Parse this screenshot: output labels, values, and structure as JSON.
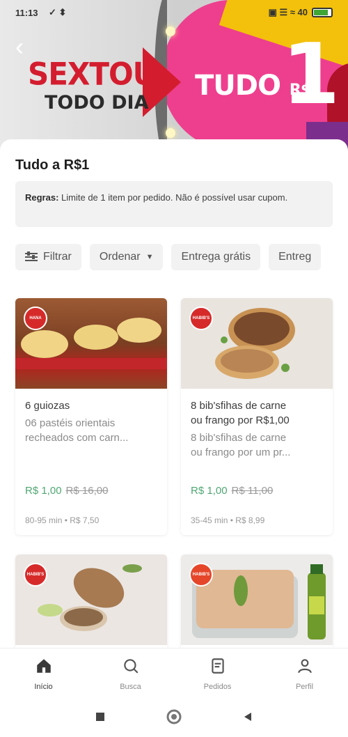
{
  "status_bar": {
    "time": "11:13",
    "left_icons": "✓ ⬍",
    "right_icons": "▣ ☰ ≈ 40",
    "battery_level": 0.85,
    "battery_color": "#3fa535"
  },
  "banner": {
    "headline": "SEXTOU",
    "subline": "TODO DIA",
    "offer_prefix": "TUDO",
    "offer_currency": "R$",
    "offer_value": "1",
    "colors": {
      "pink": "#ee3f8e",
      "red": "#d31d2f",
      "yellow": "#f3c10c"
    }
  },
  "page": {
    "title": "Tudo a R$1",
    "back_icon": "chevron-left-icon"
  },
  "rules": {
    "label": "Regras:",
    "text": " Limite de 1 item por pedido. Não é possível usar cupom."
  },
  "filters": [
    {
      "label": "Filtrar",
      "icon": "sliders-icon"
    },
    {
      "label": "Ordenar",
      "icon": "chevron-down-icon"
    },
    {
      "label": "Entrega grátis"
    },
    {
      "label": "Entreg"
    }
  ],
  "products": [
    {
      "name": "6 guiozas",
      "desc_line1": "06 pastéis orientais",
      "desc_line2": "recheados com carn...",
      "price": "R$ 1,00",
      "old_price": "R$ 16,00",
      "meta": "80-95 min • R$ 7,50",
      "badge": "HANA"
    },
    {
      "name_line1": "8 bib'sfihas de carne",
      "name_line2": "ou frango por R$1,00",
      "desc_line1": "8 bib'sfihas de carne",
      "desc_line2": "ou frango por um pr...",
      "price": "R$ 1,00",
      "old_price": "R$ 11,00",
      "meta": "35-45 min • R$ 8,99",
      "badge": "HABIB'S"
    },
    {
      "badge": "HABIB'S"
    },
    {
      "badge": "HABIB'S"
    }
  ],
  "bottom_nav": [
    {
      "label": "Início",
      "icon": "home-icon",
      "active": true
    },
    {
      "label": "Busca",
      "icon": "search-icon",
      "active": false
    },
    {
      "label": "Pedidos",
      "icon": "orders-icon",
      "active": false
    },
    {
      "label": "Perfil",
      "icon": "profile-icon",
      "active": false
    }
  ],
  "system_nav": {
    "icons": [
      "square-icon",
      "circle-icon",
      "triangle-back-icon"
    ]
  },
  "accent_color": "#50a773"
}
